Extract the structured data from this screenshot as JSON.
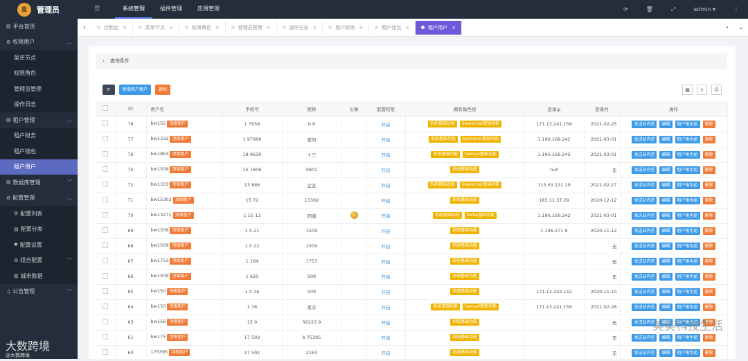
{
  "brand": {
    "logo_text": "皇",
    "title": "管理员"
  },
  "topnav": {
    "collapse_icon": "menu-icon",
    "items": [
      {
        "label": "系统管理",
        "active": true
      },
      {
        "label": "插件管理",
        "active": false
      },
      {
        "label": "应用管理",
        "active": false
      }
    ]
  },
  "header_right": {
    "refresh_icon": "refresh-icon",
    "trash_icon": "trash-icon",
    "fullscreen_icon": "fullscreen-icon",
    "user": "admin"
  },
  "sidebar": [
    {
      "label": "平台首页",
      "type": "grp",
      "icon": "▥"
    },
    {
      "label": "权限用户",
      "type": "grp",
      "icon": "⚙",
      "chev": "︿"
    },
    {
      "label": "菜单节点",
      "type": "sub"
    },
    {
      "label": "权限角色",
      "type": "sub"
    },
    {
      "label": "管理员管理",
      "type": "sub"
    },
    {
      "label": "操作日志",
      "type": "sub"
    },
    {
      "label": "租户管理",
      "type": "grp",
      "icon": "▤",
      "chev": "︿"
    },
    {
      "label": "租户财务",
      "type": "sub"
    },
    {
      "label": "租户钱包",
      "type": "sub"
    },
    {
      "label": "租户用户",
      "type": "sub",
      "active": true
    },
    {
      "label": "数据库管理",
      "type": "grp",
      "icon": "▤",
      "chev": "﹀"
    },
    {
      "label": "配置管理",
      "type": "grp",
      "icon": "⚙",
      "chev": "︿"
    },
    {
      "label": "配置列表",
      "type": "sub",
      "icon": "⚙"
    },
    {
      "label": "配置分类",
      "type": "sub",
      "icon": "▤"
    },
    {
      "label": "配置设置",
      "type": "sub",
      "icon": "✱"
    },
    {
      "label": "组合配置",
      "type": "sub",
      "icon": "⚙",
      "chev": "﹀"
    },
    {
      "label": "城市数据",
      "type": "sub",
      "icon": "▥"
    },
    {
      "label": "公告管理",
      "type": "grp",
      "icon": "♫",
      "chev": "﹀"
    }
  ],
  "tabs": [
    {
      "label": "控制台"
    },
    {
      "label": "菜单节点"
    },
    {
      "label": "权限角色"
    },
    {
      "label": "管理员管理"
    },
    {
      "label": "操作日志"
    },
    {
      "label": "租户财务"
    },
    {
      "label": "租户钱包"
    },
    {
      "label": "租户用户",
      "active": true
    }
  ],
  "query_label": "查询条件",
  "toolbar": {
    "refresh": "⟳",
    "add": "新增用户租户",
    "delete": "删除"
  },
  "table": {
    "headers": [
      "ID",
      "用户名",
      "手机号",
      "昵称",
      "头像",
      "配置权限",
      "拥有角色组",
      "登录ip",
      "登录时",
      "操作"
    ],
    "badge": "顶级租户",
    "open": "开启",
    "actions": [
      "发送站内信",
      "编辑",
      "租户角色组",
      "删除"
    ],
    "rows": [
      {
        "id": "78",
        "user": "bw155",
        "phone": "1 7956",
        "nick": "b 6",
        "roles": [
          "系统基础功能",
          "bwwechat基础功能"
        ],
        "ip": "171.13.241.156",
        "date": "2021-02-25"
      },
      {
        "id": "77",
        "user": "bw1332",
        "phone": "1 97966",
        "nick": "爱的",
        "roles": [
          "系统基础功能",
          "bwmanor基础功能"
        ],
        "ip": "1.196.169.242",
        "date": "2021-03-01"
      },
      {
        "id": "76",
        "user": "bw1863",
        "phone": "18 9630",
        "nick": "十三",
        "roles": [
          "系统基础功能",
          "bwmall基础功能"
        ],
        "ip": "1.196.169.242",
        "date": "2021-03-01"
      },
      {
        "id": "75",
        "user": "bw1509",
        "phone": "15 1806",
        "nick": "0901",
        "roles": [
          "系统基础功能"
        ],
        "ip": "null",
        "date": "无"
      },
      {
        "id": "72",
        "user": "bw1333",
        "phone": "13 886",
        "nick": "企业",
        "roles": [
          "系统基础功能",
          "bwwechat基础功能"
        ],
        "ip": "115.63.131.19",
        "date": "2021-02-27"
      },
      {
        "id": "71",
        "user": "bw15302",
        "phone": "15 72",
        "nick": "15302",
        "roles": [
          "系统基础功能"
        ],
        "ip": "183.11.37.29",
        "date": "2020-12-12"
      },
      {
        "id": "70",
        "user": "bw13271",
        "phone": "1 15 13",
        "nick": "同道",
        "avatar": true,
        "roles": [
          "系统基础功能",
          "bwbe基础功能"
        ],
        "ip": "1.196.169.242",
        "date": "2021-03-01"
      },
      {
        "id": "69",
        "user": "bw1509",
        "phone": "1 0 21",
        "nick": "1509",
        "roles": [
          "系统基础功能"
        ],
        "ip": "1.196.171.9",
        "date": "2020-11-12"
      },
      {
        "id": "68",
        "user": "bw1509",
        "phone": "1 0 22",
        "nick": "1509",
        "roles": [
          "系统基础功能"
        ],
        "ip": "",
        "date": "无"
      },
      {
        "id": "67",
        "user": "bw1753",
        "phone": "1 164",
        "nick": "1753",
        "roles": [
          "系统基础功能"
        ],
        "ip": "",
        "date": "无"
      },
      {
        "id": "66",
        "user": "bw1509",
        "phone": "1 620",
        "nick": "509",
        "roles": [
          "系统基础功能"
        ],
        "ip": "",
        "date": "无"
      },
      {
        "id": "65",
        "user": "bw150",
        "phone": "1 0 16",
        "nick": "509",
        "roles": [
          "系统基础功能"
        ],
        "ip": "171.13.242.152",
        "date": "2020-11-10"
      },
      {
        "id": "64",
        "user": "bw150",
        "phone": "1 16",
        "nick": "呆方",
        "roles": [
          "系统基础功能",
          "bwmall基础功能"
        ],
        "ip": "171.13.241.156",
        "date": "2021-02-26"
      },
      {
        "id": "63",
        "user": "bw156",
        "phone": "15 9",
        "nick": "56223 9",
        "roles": [
          "系统基础功能"
        ],
        "ip": "",
        "date": "无"
      },
      {
        "id": "61",
        "user": "bw175",
        "phone": "17 592",
        "nick": "b 75395",
        "roles": [
          "系统基础功能"
        ],
        "ip": "",
        "date": "无"
      },
      {
        "id": "60",
        "user": "175395",
        "phone": "17 592",
        "nick": "2163",
        "roles": [
          "系统基础功能"
        ],
        "ip": "",
        "date": "无"
      }
    ]
  },
  "watermark_right": "美美科技生活",
  "watermark_left": {
    "main": "大数跨境",
    "sub": "@大数跨境"
  }
}
